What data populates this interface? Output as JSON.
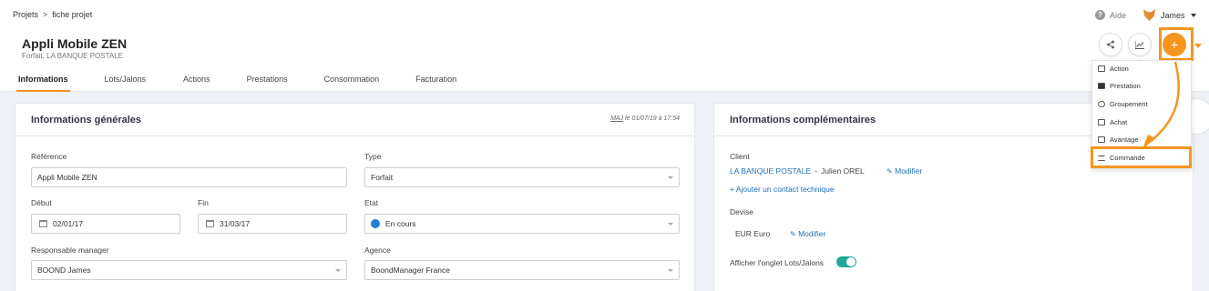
{
  "breadcrumb": {
    "root": "Projets",
    "separator": ">",
    "current": "fiche projet"
  },
  "project": {
    "title": "Appli Mobile ZEN",
    "subtitle": "Forfait, LA BANQUE POSTALE"
  },
  "header": {
    "help_label": "Aide",
    "user_name": "James"
  },
  "tabs": [
    {
      "label": "Informations"
    },
    {
      "label": "Lots/Jalons"
    },
    {
      "label": "Actions"
    },
    {
      "label": "Prestations"
    },
    {
      "label": "Consommation"
    },
    {
      "label": "Facturation"
    }
  ],
  "general": {
    "title": "Informations générales",
    "maj_prefix": "MAJ",
    "maj_suffix": "le 01/07/19 à 17:54",
    "reference_label": "Référence",
    "reference_value": "Appli Mobile ZEN",
    "type_label": "Type",
    "type_value": "Forfait",
    "debut_label": "Début",
    "debut_value": "02/01/17",
    "fin_label": "Fin",
    "fin_value": "31/03/17",
    "etat_label": "Etat",
    "etat_value": "En cours",
    "manager_label": "Responsable manager",
    "manager_value": "BOOND James",
    "agence_label": "Agence",
    "agence_value": "BoondManager France"
  },
  "complementary": {
    "title": "Informations complémentaires",
    "client_label": "Client",
    "client_company": "LA BANQUE POSTALE",
    "client_dash": "-",
    "client_contact": "Julien OREL",
    "modify": "Modifier",
    "add_contact": "+ Ajouter un contact technique",
    "devise_label": "Devise",
    "devise_value": "EUR Euro",
    "modify2": "Modifier",
    "lots_toggle_label": "Afficher l'onglet Lots/Jalons"
  },
  "plus_menu": {
    "button": "+",
    "items": [
      {
        "label": "Action",
        "icon": "action-icon"
      },
      {
        "label": "Prestation",
        "icon": "briefcase-icon"
      },
      {
        "label": "Groupement",
        "icon": "database-icon"
      },
      {
        "label": "Achat",
        "icon": "cart-icon"
      },
      {
        "label": "Avantage",
        "icon": "gift-icon"
      },
      {
        "label": "Commande",
        "icon": "list-icon"
      }
    ]
  },
  "colors": {
    "accent": "#f7941d",
    "link": "#1f6fb6",
    "status": "#1e7fd6",
    "toggle": "#1fa89a"
  },
  "toggles": {
    "lots_jalons": true
  }
}
